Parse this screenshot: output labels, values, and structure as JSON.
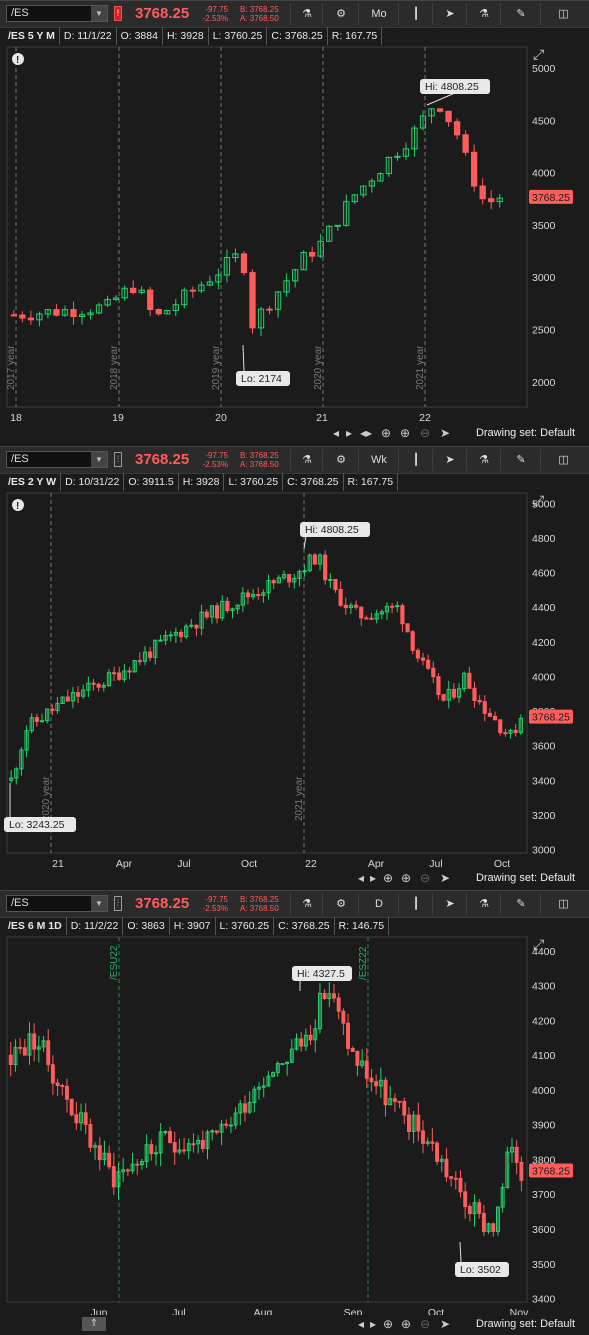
{
  "common": {
    "symbol": "/ES",
    "last_price": "3768.25",
    "change": "-97.75",
    "change_pct": "-2.53%",
    "bid": "B: 3768.25",
    "ask": "A: 3768.50",
    "drawing_set": "Drawing set: Default",
    "price_tag": "3768.25",
    "colors": {
      "up": "#26d26a",
      "down": "#ff5c5c",
      "grid": "#5a5a5a",
      "bg": "#1b1b1b",
      "tag": "#ff5c5c"
    }
  },
  "charts": [
    {
      "aggregation": "Mo",
      "info": [
        "/ES 5 Y M",
        "D: 11/1/22",
        "O: 3884",
        "H: 3928",
        "L: 3760.25",
        "C: 3768.25",
        "R: 167.75"
      ],
      "yticks": [
        "5000",
        "4500",
        "4000",
        "3500",
        "3000",
        "2500",
        "2000"
      ],
      "xticks": [
        "18",
        "19",
        "20",
        "21",
        "22"
      ],
      "markers": [
        "2017 year",
        "2018 year",
        "2019 year",
        "2020 year",
        "2021 year"
      ],
      "hi_label": "Hi: 4808.25",
      "lo_label": "Lo: 2174",
      "alert_icon": "exclamation-icon"
    },
    {
      "aggregation": "Wk",
      "info": [
        "/ES 2 Y W",
        "D: 10/31/22",
        "O: 3911.5",
        "H: 3928",
        "L: 3760.25",
        "C: 3768.25",
        "R: 167.75"
      ],
      "yticks": [
        "5000",
        "4800",
        "4600",
        "4400",
        "4200",
        "4000",
        "3800",
        "3600",
        "3400",
        "3200",
        "3000"
      ],
      "xticks": [
        "21",
        "Apr",
        "Jul",
        "Oct",
        "22",
        "Apr",
        "Jul",
        "Oct"
      ],
      "markers": [
        "2020 year",
        "2021 year"
      ],
      "hi_label": "Hi: 4808.25",
      "lo_label": "Lo: 3243.25",
      "alert_icon": "exclamation-icon"
    },
    {
      "aggregation": "D",
      "info": [
        "/ES 6 M 1D",
        "D: 11/2/22",
        "O: 3863",
        "H: 3907",
        "L: 3760.25",
        "C: 3768.25",
        "R: 146.75"
      ],
      "yticks": [
        "4400",
        "4300",
        "4200",
        "4100",
        "4000",
        "3900",
        "3800",
        "3700",
        "3600",
        "3500",
        "3400"
      ],
      "xticks": [
        "Jun",
        "Jul",
        "Aug",
        "Sep",
        "Oct",
        "Nov"
      ],
      "markers": [
        "/ESU22",
        "/ESZ22"
      ],
      "hi_label": "Hi: 4327.5",
      "lo_label": "Lo: 3502"
    }
  ],
  "chart_data": [
    {
      "type": "candlestick",
      "title": "/ES 5 Y M",
      "ylim": [
        1800,
        5150
      ],
      "hi": 4808.25,
      "lo": 2174,
      "last": 3768.25,
      "series_close_approx": [
        2690,
        2700,
        2660,
        2720,
        2800,
        2920,
        2650,
        2900,
        2740,
        2800,
        2850,
        2900,
        2950,
        2980,
        3020,
        3080,
        3000,
        2580,
        2900,
        3130,
        3220,
        3230,
        3140,
        2580,
        2950,
        3050,
        3270,
        3500,
        3360,
        3620,
        3700,
        3810,
        3970,
        4140,
        4200,
        4400,
        4600,
        4500,
        4700,
        4770,
        4570,
        4130,
        4500,
        4130,
        3780,
        4130,
        3950,
        3600,
        3870,
        3768
      ]
    },
    {
      "type": "candlestick",
      "title": "/ES 2 Y W",
      "ylim": [
        3000,
        5000
      ],
      "hi": 4808.25,
      "lo": 3243.25,
      "last": 3768.25
    },
    {
      "type": "candlestick",
      "title": "/ES 6 M 1D",
      "ylim": [
        3380,
        4440
      ],
      "hi": 4327.5,
      "lo": 3502,
      "last": 3768.25
    }
  ]
}
